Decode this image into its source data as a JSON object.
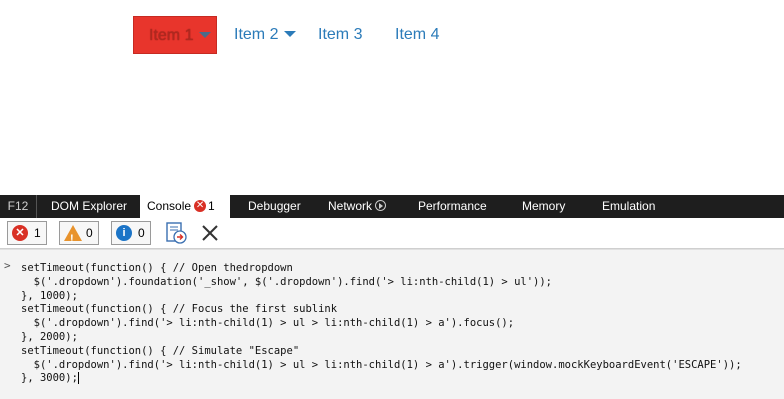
{
  "nav": {
    "items": [
      {
        "label": "Item 1",
        "has_dropdown": true,
        "active": true
      },
      {
        "label": "Item 2",
        "has_dropdown": true
      },
      {
        "label": "Item 3"
      },
      {
        "label": "Item 4"
      }
    ],
    "active_bg": "#e8352c",
    "link_color": "#2b7bb9"
  },
  "devtools": {
    "tabs": {
      "f12": "F12",
      "dom": "DOM Explorer",
      "console": "Console",
      "console_errors": "1",
      "debugger": "Debugger",
      "network": "Network",
      "performance": "Performance",
      "memory": "Memory",
      "emulation": "Emulation"
    },
    "toolbar": {
      "errors": "1",
      "warnings": "0",
      "info": "0"
    },
    "console": {
      "prompt": ">",
      "lines": [
        "setTimeout(function() { // Open thedropdown",
        "  $('.dropdown').foundation('_show', $('.dropdown').find('> li:nth-child(1) > ul'));",
        "}, 1000);",
        "setTimeout(function() { // Focus the first sublink",
        "  $('.dropdown').find('> li:nth-child(1) > ul > li:nth-child(1) > a').focus();",
        "}, 2000);",
        "setTimeout(function() { // Simulate \"Escape\"",
        "  $('.dropdown').find('> li:nth-child(1) > ul > li:nth-child(1) > a').trigger(window.mockKeyboardEvent('ESCAPE'));",
        "}, 3000);"
      ]
    }
  }
}
